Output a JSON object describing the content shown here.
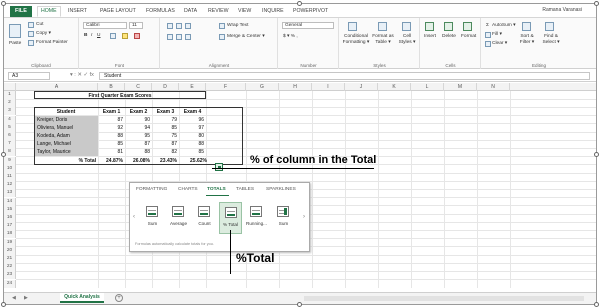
{
  "ribbon_tabs": {
    "file": "FILE",
    "items": [
      "HOME",
      "INSERT",
      "PAGE LAYOUT",
      "FORMULAS",
      "DATA",
      "REVIEW",
      "VIEW",
      "INQUIRE",
      "POWERPIVOT"
    ],
    "active": "HOME",
    "user": "Ramana Varanasi"
  },
  "ribbon": {
    "clipboard": {
      "paste": "Paste",
      "cut": "Cut",
      "copy": "Copy ▾",
      "format_painter": "Format Painter",
      "group": "Clipboard"
    },
    "font": {
      "name": "Calibri",
      "size": "11",
      "bold": "B",
      "italic": "I",
      "underline": "U",
      "group": "Font"
    },
    "alignment": {
      "wrap": "Wrap Text",
      "merge": "Merge & Center ▾",
      "group": "Alignment"
    },
    "number": {
      "format": "General",
      "currency": "$ ▾ % ,",
      "group": "Number"
    },
    "styles": {
      "conditional": "Conditional Formatting ▾",
      "format_table": "Format as Table ▾",
      "cell_styles": "Cell Styles ▾",
      "group": "Styles"
    },
    "cells": {
      "insert": "Insert",
      "delete": "Delete",
      "format": "Format",
      "group": "Cells"
    },
    "editing": {
      "autosum": "AutoSum ▾",
      "fill": "Fill ▾",
      "clear": "Clear ▾",
      "sort": "Sort & Filter ▾",
      "find": "Find & Select ▾",
      "group": "Editing"
    }
  },
  "formula_bar": {
    "name_box": "A3",
    "fx_icons": "▾ : ✕ ✓ fx",
    "formula": "Student"
  },
  "columns": [
    "A",
    "B",
    "C",
    "D",
    "E",
    "F",
    "G",
    "H",
    "I",
    "J",
    "K",
    "L",
    "M",
    "N"
  ],
  "rows": [
    "1",
    "2",
    "3",
    "4",
    "5",
    "6",
    "7",
    "8",
    "9",
    "10",
    "11",
    "12",
    "13",
    "14",
    "15",
    "16",
    "17",
    "18",
    "19",
    "20",
    "21",
    "22",
    "23",
    "24"
  ],
  "sheet": {
    "title": "First Quarter Exam Scores",
    "headers": [
      "Student",
      "Exam 1",
      "Exam 2",
      "Exam 3",
      "Exam 4"
    ],
    "students": [
      {
        "name": "Kreiger, Doris",
        "scores": [
          "87",
          "90",
          "79",
          "96"
        ]
      },
      {
        "name": "Oliviera, Manuel",
        "scores": [
          "92",
          "94",
          "85",
          "97"
        ]
      },
      {
        "name": "Kodeda, Adam",
        "scores": [
          "88",
          "95",
          "75",
          "80"
        ]
      },
      {
        "name": "Lange, Michael",
        "scores": [
          "85",
          "87",
          "87",
          "88"
        ]
      },
      {
        "name": "Taylor, Maurice",
        "scores": [
          "81",
          "88",
          "82",
          "85"
        ]
      }
    ],
    "total_label": "% Total",
    "totals": [
      "24.87%",
      "26.08%",
      "23.43%",
      "25.62%"
    ]
  },
  "quick_analysis": {
    "tabs": [
      "FORMATTING",
      "CHARTS",
      "TOTALS",
      "TABLES",
      "SPARKLINES"
    ],
    "active_tab": "TOTALS",
    "items": [
      "Sum",
      "Average",
      "Count",
      "% Total",
      "Running...",
      "Sum"
    ],
    "selected_item": "% Total",
    "note": "Formulas automatically calculate totals for you."
  },
  "callouts": {
    "column_total": "% of column in the Total",
    "percent_total": "%Total"
  },
  "sheet_tabs": {
    "active": "Quick Analysis",
    "add": "+"
  }
}
